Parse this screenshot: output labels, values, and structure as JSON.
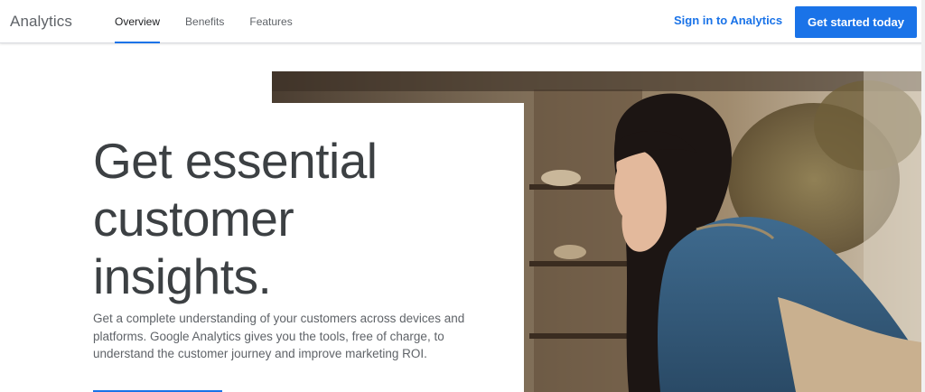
{
  "header": {
    "brand": "Analytics",
    "nav": [
      {
        "label": "Overview",
        "active": true
      },
      {
        "label": "Benefits",
        "active": false
      },
      {
        "label": "Features",
        "active": false
      }
    ],
    "signin_label": "Sign in to Analytics",
    "cta_label": "Get started today"
  },
  "hero": {
    "title_lines": [
      "Get essential",
      "customer",
      "insights."
    ],
    "description": "Get a complete understanding of your customers across devices and platforms. Google Analytics gives you the tools, free of charge, to understand the customer journey and improve marketing ROI."
  },
  "colors": {
    "accent": "#1a73e8",
    "text_primary": "#3c4043",
    "text_secondary": "#5f6368"
  }
}
